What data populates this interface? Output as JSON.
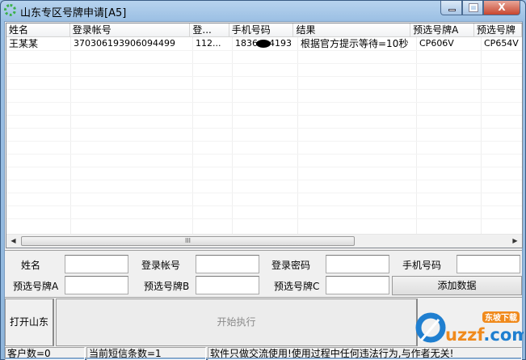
{
  "window": {
    "title": "山东专区号牌申请[A5]",
    "close_label": "X"
  },
  "table": {
    "columns": [
      "姓名",
      "登录帐号",
      "登...",
      "手机号码",
      "结果",
      "预选号牌A",
      "预选号牌"
    ],
    "rows": [
      {
        "name": "王某某",
        "account": "370306193906094499",
        "password": "112...",
        "phone_prefix": "1836",
        "phone_suffix": "4193",
        "result": "根据官方提示等待=10秒",
        "plate_a": "CP606V",
        "plate_b": "CP654V"
      }
    ],
    "scrollbar_thumb_label": "III"
  },
  "form": {
    "name_label": "姓名",
    "account_label": "登录帐号",
    "password_label": "登录密码",
    "phone_label": "手机号码",
    "plate_a_label": "预选号牌A",
    "plate_b_label": "预选号牌B",
    "plate_c_label": "预选号牌C",
    "add_button": "添加数据"
  },
  "actions": {
    "open_shandong": "打开山东",
    "start": "开始执行"
  },
  "status": {
    "customers": "客户数=0",
    "sms_count": "当前短信条数=1",
    "notice": "软件只做交流使用!使用过程中任何违法行为,与作者无关!"
  },
  "watermark": {
    "text": "uzzf.com",
    "badge": "东坡下载"
  }
}
